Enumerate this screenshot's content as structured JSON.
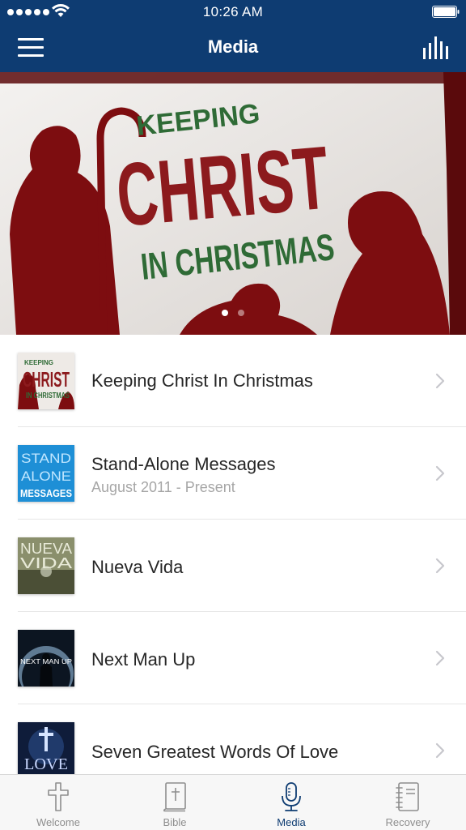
{
  "status_bar": {
    "time": "10:26 AM"
  },
  "nav": {
    "title": "Media",
    "menu_icon": "hamburger-menu-icon",
    "right_icon": "equalizer-icon"
  },
  "hero": {
    "line1": "KEEPING",
    "line2": "CHRIST",
    "line3": "IN CHRISTMAS",
    "page_count": 2,
    "active_page": 1,
    "colors": {
      "silhouette": "#7d0d10",
      "christ": "#8c1a1d",
      "green": "#2f6b36"
    }
  },
  "items": [
    {
      "title": "Keeping Christ In Christmas",
      "subtitle": "",
      "thumb": "keeping-christ-thumbnail"
    },
    {
      "title": "Stand-Alone Messages",
      "subtitle": "August 2011 - Present",
      "thumb": "stand-alone-thumbnail"
    },
    {
      "title": "Nueva Vida",
      "subtitle": "",
      "thumb": "nueva-vida-thumbnail"
    },
    {
      "title": "Next Man Up",
      "subtitle": "",
      "thumb": "next-man-up-thumbnail"
    },
    {
      "title": "Seven Greatest Words Of Love",
      "subtitle": "",
      "thumb": "seven-greatest-words-thumbnail"
    }
  ],
  "thumb_text": {
    "keeping": {
      "a": "KEEPING",
      "b": "CHRIST",
      "c": "IN CHRISTMAS"
    },
    "stand": {
      "a": "STAND",
      "b": "ALONE",
      "c": "MESSAGES"
    },
    "nueva": {
      "a": "NUEVA",
      "b": "VIDA"
    },
    "nextman": {
      "a": "NEXT MAN UP"
    },
    "seven": {
      "a": "LOVE"
    }
  },
  "tabs": [
    {
      "label": "Welcome",
      "icon": "cross-icon",
      "active": false
    },
    {
      "label": "Bible",
      "icon": "bible-icon",
      "active": false
    },
    {
      "label": "Media",
      "icon": "microphone-icon",
      "active": true
    },
    {
      "label": "Recovery",
      "icon": "notebook-icon",
      "active": false
    }
  ],
  "colors": {
    "nav_bg": "#0e3c72",
    "accent": "#0e3c72",
    "tab_idle": "#8e8e8e"
  }
}
